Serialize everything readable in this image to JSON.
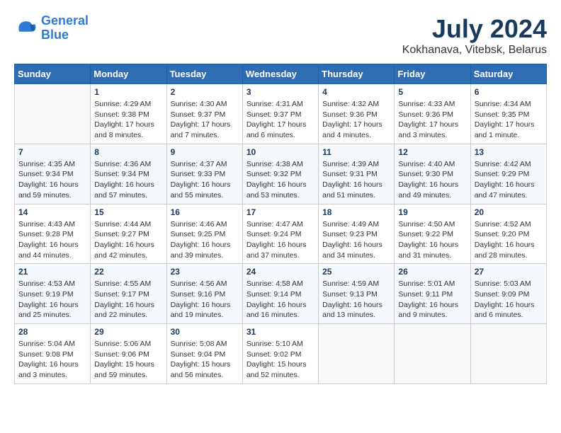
{
  "header": {
    "logo_line1": "General",
    "logo_line2": "Blue",
    "month_year": "July 2024",
    "location": "Kokhanava, Vitebsk, Belarus"
  },
  "weekdays": [
    "Sunday",
    "Monday",
    "Tuesday",
    "Wednesday",
    "Thursday",
    "Friday",
    "Saturday"
  ],
  "weeks": [
    [
      {
        "day": "",
        "info": ""
      },
      {
        "day": "1",
        "info": "Sunrise: 4:29 AM\nSunset: 9:38 PM\nDaylight: 17 hours\nand 8 minutes."
      },
      {
        "day": "2",
        "info": "Sunrise: 4:30 AM\nSunset: 9:37 PM\nDaylight: 17 hours\nand 7 minutes."
      },
      {
        "day": "3",
        "info": "Sunrise: 4:31 AM\nSunset: 9:37 PM\nDaylight: 17 hours\nand 6 minutes."
      },
      {
        "day": "4",
        "info": "Sunrise: 4:32 AM\nSunset: 9:36 PM\nDaylight: 17 hours\nand 4 minutes."
      },
      {
        "day": "5",
        "info": "Sunrise: 4:33 AM\nSunset: 9:36 PM\nDaylight: 17 hours\nand 3 minutes."
      },
      {
        "day": "6",
        "info": "Sunrise: 4:34 AM\nSunset: 9:35 PM\nDaylight: 17 hours\nand 1 minute."
      }
    ],
    [
      {
        "day": "7",
        "info": "Sunrise: 4:35 AM\nSunset: 9:34 PM\nDaylight: 16 hours\nand 59 minutes."
      },
      {
        "day": "8",
        "info": "Sunrise: 4:36 AM\nSunset: 9:34 PM\nDaylight: 16 hours\nand 57 minutes."
      },
      {
        "day": "9",
        "info": "Sunrise: 4:37 AM\nSunset: 9:33 PM\nDaylight: 16 hours\nand 55 minutes."
      },
      {
        "day": "10",
        "info": "Sunrise: 4:38 AM\nSunset: 9:32 PM\nDaylight: 16 hours\nand 53 minutes."
      },
      {
        "day": "11",
        "info": "Sunrise: 4:39 AM\nSunset: 9:31 PM\nDaylight: 16 hours\nand 51 minutes."
      },
      {
        "day": "12",
        "info": "Sunrise: 4:40 AM\nSunset: 9:30 PM\nDaylight: 16 hours\nand 49 minutes."
      },
      {
        "day": "13",
        "info": "Sunrise: 4:42 AM\nSunset: 9:29 PM\nDaylight: 16 hours\nand 47 minutes."
      }
    ],
    [
      {
        "day": "14",
        "info": "Sunrise: 4:43 AM\nSunset: 9:28 PM\nDaylight: 16 hours\nand 44 minutes."
      },
      {
        "day": "15",
        "info": "Sunrise: 4:44 AM\nSunset: 9:27 PM\nDaylight: 16 hours\nand 42 minutes."
      },
      {
        "day": "16",
        "info": "Sunrise: 4:46 AM\nSunset: 9:25 PM\nDaylight: 16 hours\nand 39 minutes."
      },
      {
        "day": "17",
        "info": "Sunrise: 4:47 AM\nSunset: 9:24 PM\nDaylight: 16 hours\nand 37 minutes."
      },
      {
        "day": "18",
        "info": "Sunrise: 4:49 AM\nSunset: 9:23 PM\nDaylight: 16 hours\nand 34 minutes."
      },
      {
        "day": "19",
        "info": "Sunrise: 4:50 AM\nSunset: 9:22 PM\nDaylight: 16 hours\nand 31 minutes."
      },
      {
        "day": "20",
        "info": "Sunrise: 4:52 AM\nSunset: 9:20 PM\nDaylight: 16 hours\nand 28 minutes."
      }
    ],
    [
      {
        "day": "21",
        "info": "Sunrise: 4:53 AM\nSunset: 9:19 PM\nDaylight: 16 hours\nand 25 minutes."
      },
      {
        "day": "22",
        "info": "Sunrise: 4:55 AM\nSunset: 9:17 PM\nDaylight: 16 hours\nand 22 minutes."
      },
      {
        "day": "23",
        "info": "Sunrise: 4:56 AM\nSunset: 9:16 PM\nDaylight: 16 hours\nand 19 minutes."
      },
      {
        "day": "24",
        "info": "Sunrise: 4:58 AM\nSunset: 9:14 PM\nDaylight: 16 hours\nand 16 minutes."
      },
      {
        "day": "25",
        "info": "Sunrise: 4:59 AM\nSunset: 9:13 PM\nDaylight: 16 hours\nand 13 minutes."
      },
      {
        "day": "26",
        "info": "Sunrise: 5:01 AM\nSunset: 9:11 PM\nDaylight: 16 hours\nand 9 minutes."
      },
      {
        "day": "27",
        "info": "Sunrise: 5:03 AM\nSunset: 9:09 PM\nDaylight: 16 hours\nand 6 minutes."
      }
    ],
    [
      {
        "day": "28",
        "info": "Sunrise: 5:04 AM\nSunset: 9:08 PM\nDaylight: 16 hours\nand 3 minutes."
      },
      {
        "day": "29",
        "info": "Sunrise: 5:06 AM\nSunset: 9:06 PM\nDaylight: 15 hours\nand 59 minutes."
      },
      {
        "day": "30",
        "info": "Sunrise: 5:08 AM\nSunset: 9:04 PM\nDaylight: 15 hours\nand 56 minutes."
      },
      {
        "day": "31",
        "info": "Sunrise: 5:10 AM\nSunset: 9:02 PM\nDaylight: 15 hours\nand 52 minutes."
      },
      {
        "day": "",
        "info": ""
      },
      {
        "day": "",
        "info": ""
      },
      {
        "day": "",
        "info": ""
      }
    ]
  ]
}
